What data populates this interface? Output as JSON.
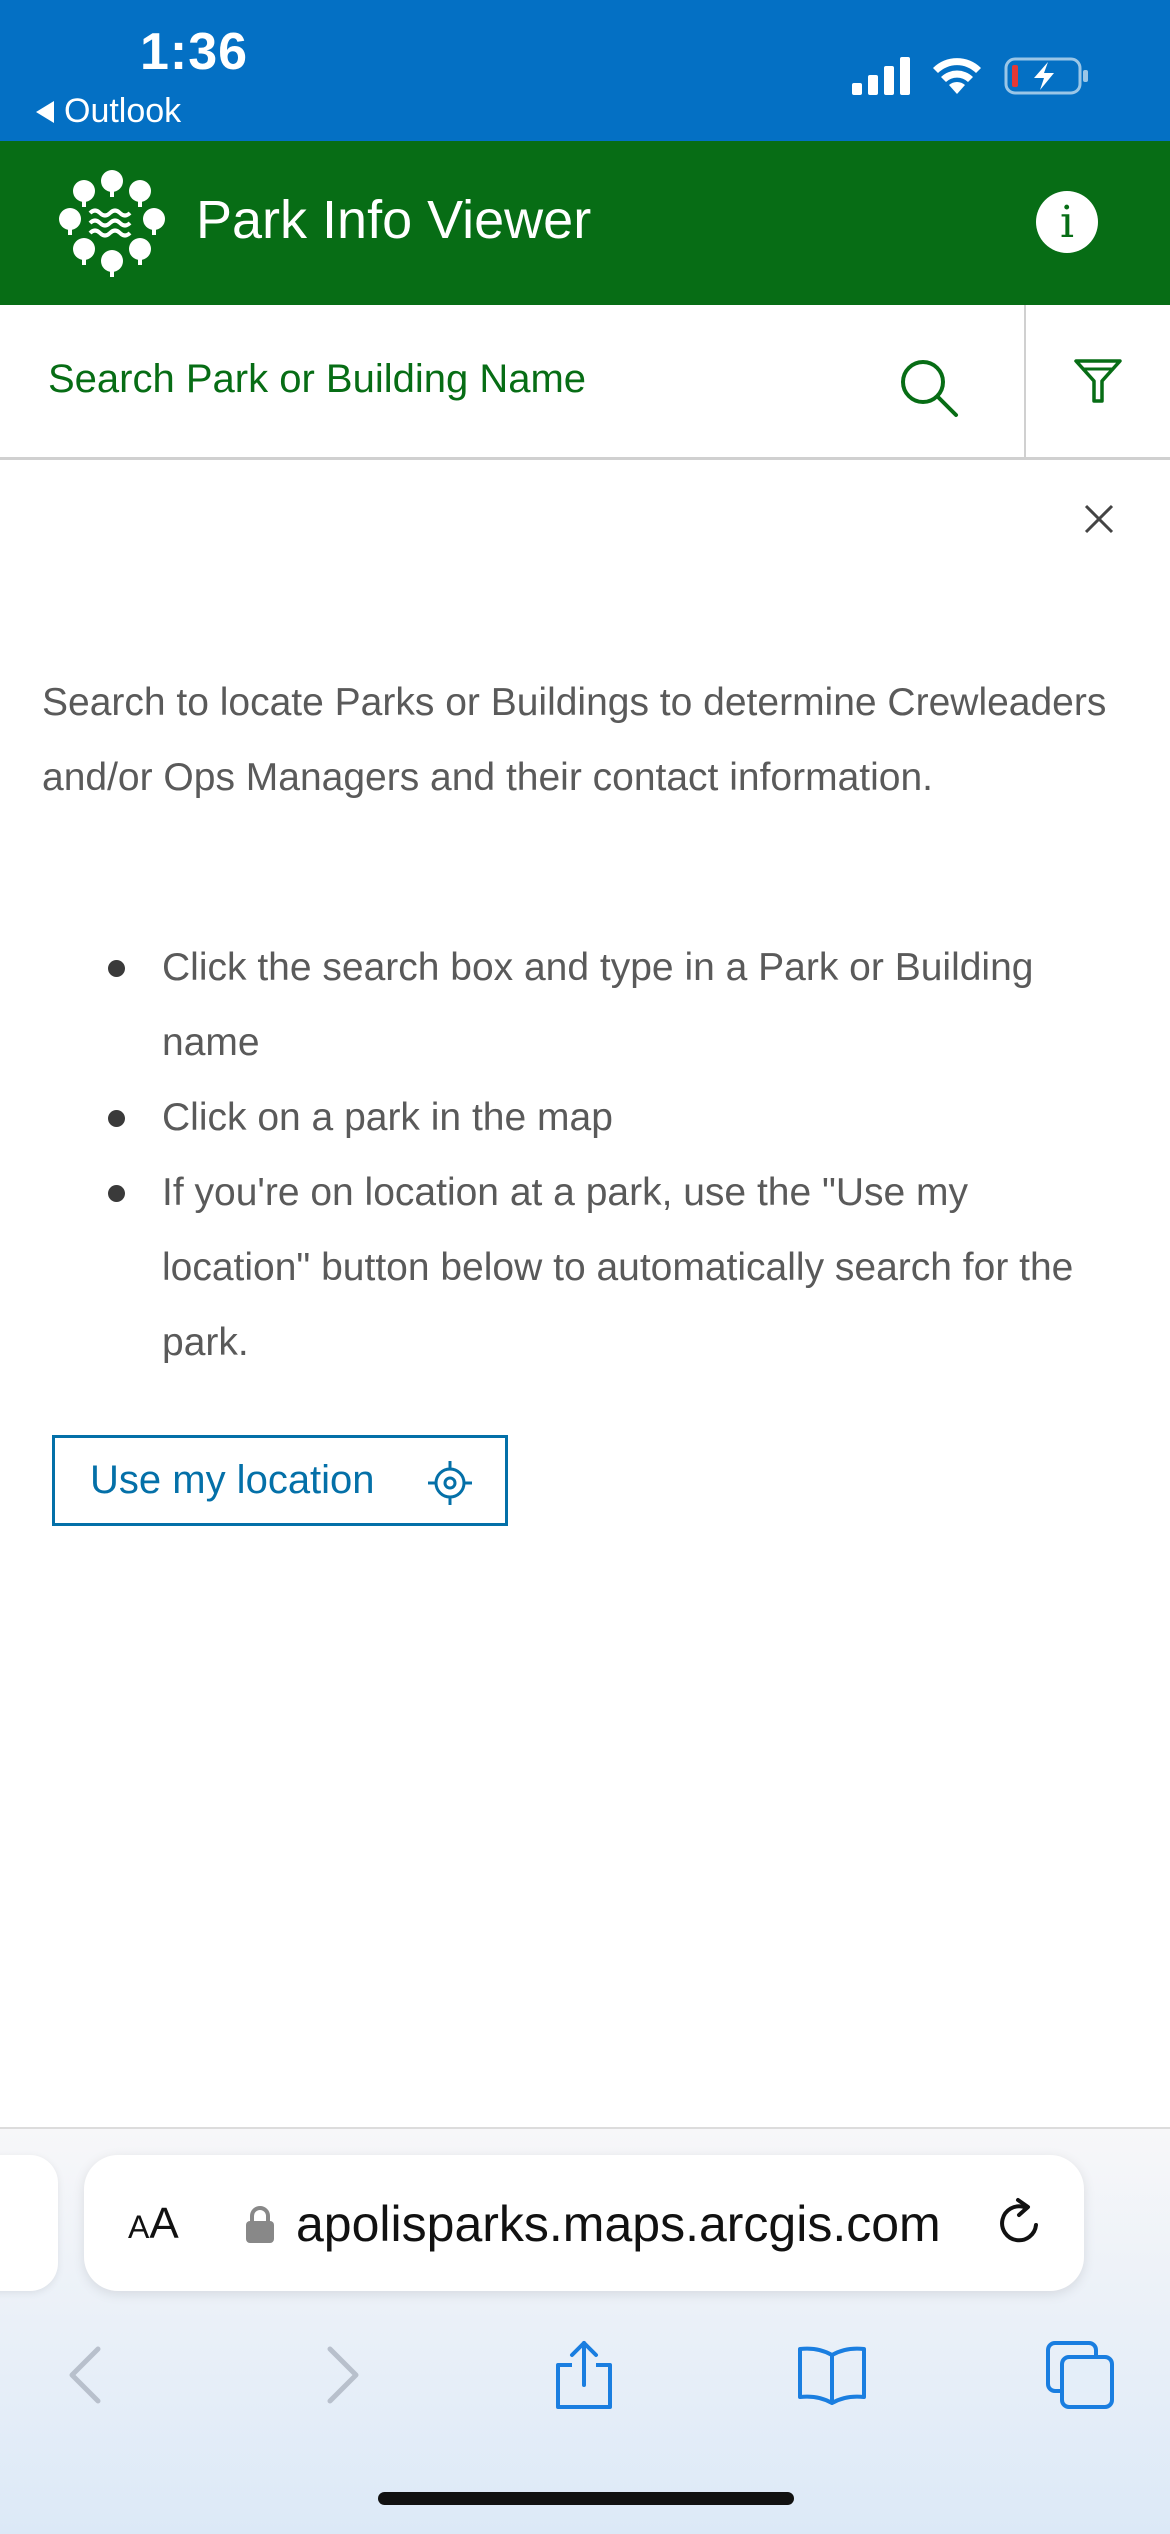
{
  "status_bar": {
    "time": "1:36",
    "back_app": "Outlook",
    "icons": [
      "cellular-signal-icon",
      "wifi-icon",
      "battery-charging-icon"
    ],
    "color": "#0470c4"
  },
  "app_header": {
    "title": "Park Info Viewer",
    "logo": "park-trees-logo",
    "info_icon": "info-icon",
    "color": "#076d15"
  },
  "search": {
    "placeholder": "Search Park or Building Name",
    "search_icon": "search-icon",
    "filter_icon": "filter-icon"
  },
  "panel": {
    "close_icon": "close-icon",
    "intro": "Search to locate Parks or Buildings to determine Crewleaders and/or Ops Managers and their contact information.",
    "bullets": [
      "Click the search box and type in a Park or Building name",
      "Click on a park in the map",
      "If you're on location at a park, use the \"Use my location\" button below to automatically search for the park."
    ],
    "location_button": "Use my location",
    "location_icon": "crosshair-icon"
  },
  "browser": {
    "text_size_label_small": "A",
    "text_size_label_large": "A",
    "url": "apolisparks.maps.arcgis.com",
    "toolbar": [
      "back-icon",
      "forward-icon",
      "share-icon",
      "bookmarks-icon",
      "tabs-icon"
    ]
  }
}
